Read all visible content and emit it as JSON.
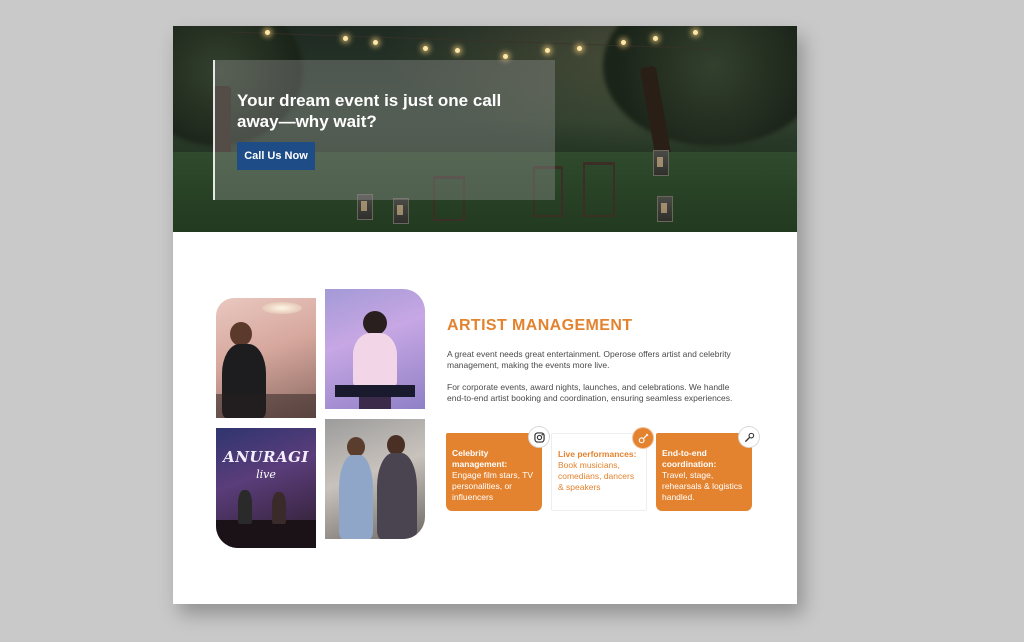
{
  "hero": {
    "headline": "Your dream event is just one call away—why wait?",
    "cta_label": "Call Us Now"
  },
  "photos": {
    "event_title": "ANURAGI",
    "event_sub": "live"
  },
  "section": {
    "title": "ARTIST MANAGEMENT",
    "paragraph1": "A great event needs great entertainment. Operose offers artist and celebrity management, making the events more live.",
    "paragraph2": "For corporate events, award nights, launches, and celebrations. We handle end-to-end artist booking and coordination, ensuring seamless experiences."
  },
  "cards": [
    {
      "title": "Celebrity management:",
      "desc": "Engage film stars, TV personalities, or influencers",
      "icon": "instagram-icon"
    },
    {
      "title": "Live performances:",
      "desc": "Book musicians, comedians, dancers & speakers",
      "icon": "guitar-icon"
    },
    {
      "title": "End-to-end coordination:",
      "desc": "Travel, stage, rehearsals & logistics handled.",
      "icon": "microphone-icon"
    }
  ],
  "colors": {
    "accent": "#e4832f",
    "button": "#1d4c86",
    "background": "#c9c9c9"
  }
}
